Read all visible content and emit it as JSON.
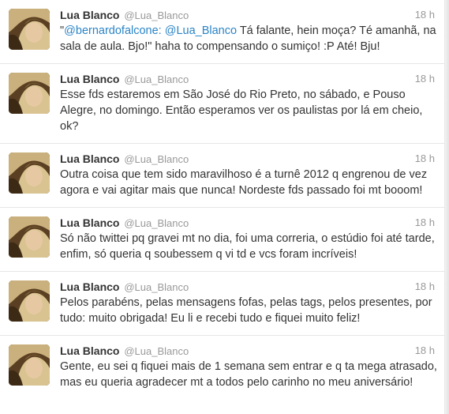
{
  "tweets": [
    {
      "fullname": "Lua Blanco",
      "username": "@Lua_Blanco",
      "time": "18 h",
      "text_pre": "\"",
      "mention": "@bernardofalcone: @Lua_Blanco",
      "text_post": " Tá falante, hein moça? Té amanhã, na sala de aula. Bjo!\" haha to compensando o sumiço! :P Até! Bju!"
    },
    {
      "fullname": "Lua Blanco",
      "username": "@Lua_Blanco",
      "time": "18 h",
      "text": "Esse fds estaremos em São José do Rio Preto, no sábado, e Pouso Alegre, no domingo. Então esperamos ver os paulistas por lá em cheio, ok?"
    },
    {
      "fullname": "Lua Blanco",
      "username": "@Lua_Blanco",
      "time": "18 h",
      "text": "Outra coisa que tem sido maravilhoso é a turnê 2012 q engrenou de vez agora e vai agitar mais que nunca! Nordeste fds passado foi mt booom!"
    },
    {
      "fullname": "Lua Blanco",
      "username": "@Lua_Blanco",
      "time": "18 h",
      "text": "Só não twittei pq gravei mt no dia, foi uma correria, o estúdio foi até tarde, enfim, só queria q soubessem q vi td e vcs foram incríveis!"
    },
    {
      "fullname": "Lua Blanco",
      "username": "@Lua_Blanco",
      "time": "18 h",
      "text": "Pelos parabéns, pelas mensagens fofas, pelas tags, pelos presentes, por tudo: muito obrigada! Eu li e recebi tudo e fiquei muito feliz!"
    },
    {
      "fullname": "Lua Blanco",
      "username": "@Lua_Blanco",
      "time": "18 h",
      "text": "Gente, eu sei q fiquei mais de 1 semana sem entrar e q ta mega atrasado, mas eu queria agradecer mt a todos pelo carinho no meu aniversário!"
    }
  ],
  "colors": {
    "link": "#2a84c6",
    "muted": "#999999",
    "text": "#333333"
  },
  "icons": {
    "avatar": "profile-photo"
  }
}
